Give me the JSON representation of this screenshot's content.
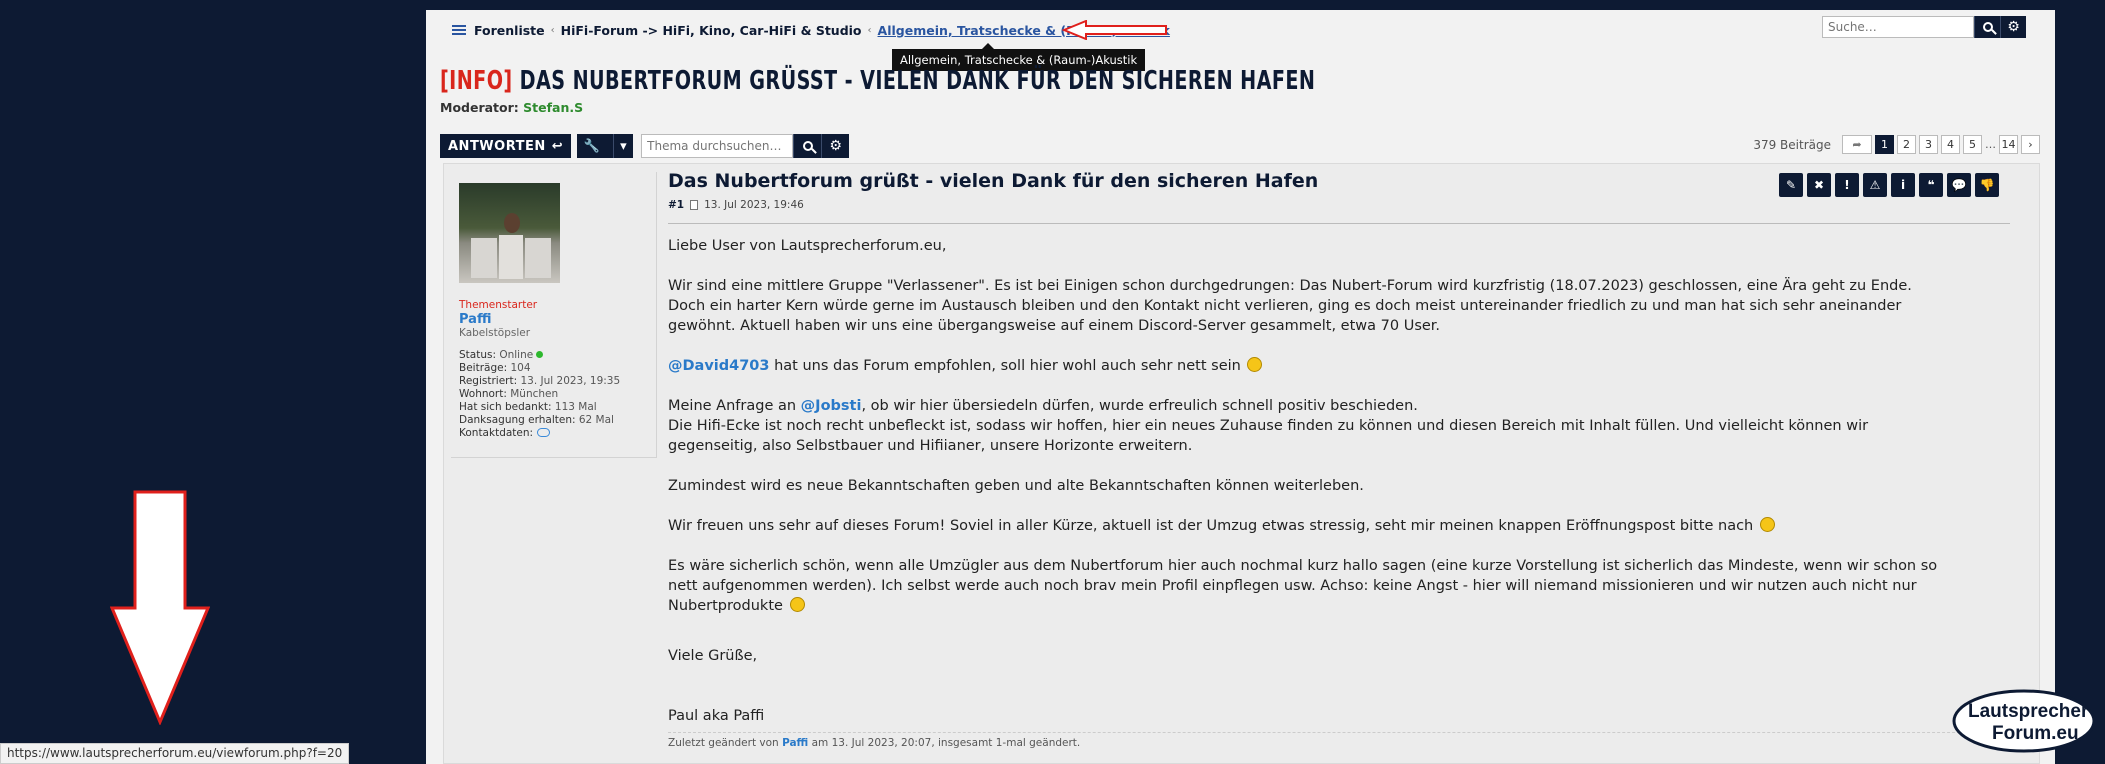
{
  "breadcrumb": {
    "items": [
      "Forenliste",
      "HiFi-Forum -> HiFi, Kino, Car-HiFi & Studio",
      "Allgemein, Tratschecke & (Raum-)Akustik"
    ],
    "tooltip": "Allgemein, Tratschecke & (Raum-)Akustik"
  },
  "search": {
    "placeholder": "Suche…"
  },
  "thread": {
    "title_tag": "[INFO]",
    "title": "Das Nubertforum grüsst - vielen Dank für den sicheren Hafen",
    "moderator_label": "Moderator:",
    "moderator": "Stefan.S"
  },
  "actions": {
    "reply_label": "ANTWORTEN",
    "thread_search_placeholder": "Thema durchsuchen…"
  },
  "pagination": {
    "count": "379 Beiträge",
    "pages": [
      "1",
      "2",
      "3",
      "4",
      "5"
    ],
    "ellipsis": "…",
    "last": "14",
    "current": "1"
  },
  "profile": {
    "role": "Themenstarter",
    "name": "Paffi",
    "rank": "Kabelstöpsler",
    "status_label": "Status:",
    "status": "Online",
    "posts_label": "Beiträge:",
    "posts": "104",
    "registered_label": "Registriert:",
    "registered": "13. Jul 2023, 19:35",
    "location_label": "Wohnort:",
    "location": "München",
    "thanked_label": "Hat sich bedankt:",
    "thanked": "113 Mal",
    "received_label": "Danksagung erhalten:",
    "received": "62 Mal",
    "contact_label": "Kontaktdaten:"
  },
  "post": {
    "title": "Das Nubertforum grüßt - vielen Dank für den sicheren Hafen",
    "number": "#1",
    "date": "13. Jul 2023, 19:46",
    "greeting": "Liebe User von Lautsprecherforum.eu,",
    "p1": "Wir sind eine mittlere Gruppe \"Verlassener\". Es ist bei Einigen schon durchgedrungen: Das Nubert-Forum wird kurzfristig (18.07.2023) geschlossen, eine Ära geht zu Ende. Doch ein harter Kern würde gerne im Austausch bleiben und den Kontakt nicht verlieren, ging es doch meist untereinander friedlich zu und man hat sich sehr aneinander gewöhnt. Aktuell haben wir uns eine übergangsweise auf einem Discord-Server gesammelt, etwa 70 User.",
    "mention1": "@David4703",
    "p2_after": " hat uns das Forum empfohlen, soll hier wohl auch sehr nett sein ",
    "p3_before": "Meine Anfrage an ",
    "mention2": "@Jobsti",
    "p3_after": ", ob wir hier übersiedeln dürfen, wurde erfreulich schnell positiv beschieden.",
    "p3_line2": "Die Hifi-Ecke ist noch recht unbefleckt ist, sodass wir hoffen, hier ein neues Zuhause finden zu können und diesen Bereich mit Inhalt füllen. Und vielleicht können wir gegenseitig, also Selbstbauer und Hifiianer, unsere Horizonte erweitern.",
    "p4": "Zumindest wird es neue Bekanntschaften geben und alte Bekanntschaften können weiterleben.",
    "p5": "Wir freuen uns sehr auf dieses Forum! Soviel in aller Kürze, aktuell ist der Umzug etwas stressig, seht mir meinen knappen Eröffnungspost bitte nach ",
    "p6": "Es wäre sicherlich schön, wenn alle Umzügler aus dem Nubertforum hier auch nochmal kurz hallo sagen (eine kurze Vorstellung ist sicherlich das Mindeste, wenn wir schon so nett aufgenommen werden). Ich selbst werde auch noch brav mein Profil einpflegen usw. Achso: keine Angst - hier will niemand missionieren und wir nutzen auch nicht nur Nubertprodukte ",
    "closing": "Viele Grüße,",
    "signature": "Paul aka Paffi",
    "edited_before": "Zuletzt geändert von ",
    "edited_by": "Paffi",
    "edited_after": " am 13. Jul 2023, 20:07, insgesamt 1-mal geändert."
  },
  "post_tools": [
    "✎",
    "✖",
    "!",
    "⚠",
    "i",
    "❝",
    "💬",
    "👎"
  ],
  "status_bar": "https://www.lautsprecherforum.eu/viewforum.php?f=20",
  "logo": {
    "line1": "Lautsprecher",
    "line2": "Forum.eu"
  },
  "colors": {
    "navy": "#0d1a33",
    "accent_red": "#d9261c",
    "link": "#2a7ac9",
    "moderator": "#2e8b2e",
    "annotation_red": "#e0201c"
  }
}
